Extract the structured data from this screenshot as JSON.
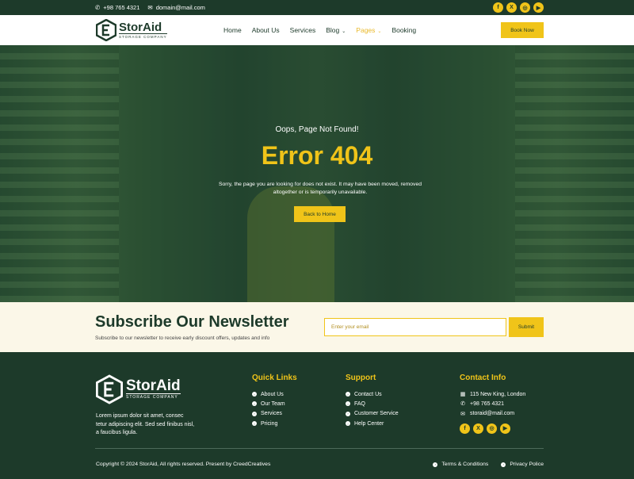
{
  "topbar": {
    "phone": "+98 765 4321",
    "email": "domain@mail.com",
    "social": [
      {
        "icon": "facebook-icon",
        "glyph": "f"
      },
      {
        "icon": "x-icon",
        "glyph": "X"
      },
      {
        "icon": "instagram-icon",
        "glyph": "◎"
      },
      {
        "icon": "youtube-icon",
        "glyph": "▶"
      }
    ]
  },
  "brand": {
    "name": "StorAid",
    "tagline": "STORAGE COMPANY"
  },
  "nav": {
    "items": [
      "Home",
      "About Us",
      "Services",
      "Blog",
      "Pages",
      "Booking"
    ],
    "book_label": "Book Now"
  },
  "hero": {
    "subtitle": "Oops, Page Not Found!",
    "title": "Error 404",
    "message": "Sorry, the page you are looking for does not exist. It may have been moved, removed altogether or is temporarily unavailable.",
    "button": "Back to Home"
  },
  "newsletter": {
    "title": "Subscribe Our Newsletter",
    "text": "Subscribe to our newsletter to receive early discount offers, updates and info",
    "placeholder": "Enter your email",
    "submit": "Submit"
  },
  "footer": {
    "description": "Lorem ipsum dolor sit amet, consec tetur adipiscing elit. Sed sed finibus nisl, a faucibus ligula.",
    "quick_links": {
      "title": "Quick Links",
      "items": [
        "About Us",
        "Our Team",
        "Services",
        "Pricing"
      ]
    },
    "support": {
      "title": "Support",
      "items": [
        "Contact Us",
        "FAQ",
        "Customer Service",
        "Help Center"
      ]
    },
    "contact": {
      "title": "Contact Info",
      "address": "115 New King, London",
      "phone": "+98 765 4321",
      "email": "storaid@mail.com"
    },
    "copyright": "Copyright © 2024 StorAid, All rights reserved. Present by CreedCreatives",
    "terms": "Terms & Conditions",
    "privacy": "Privacy Police"
  },
  "colors": {
    "dark_green": "#1d3a2a",
    "accent_yellow": "#f0c419",
    "cream": "#fbf7e8"
  }
}
